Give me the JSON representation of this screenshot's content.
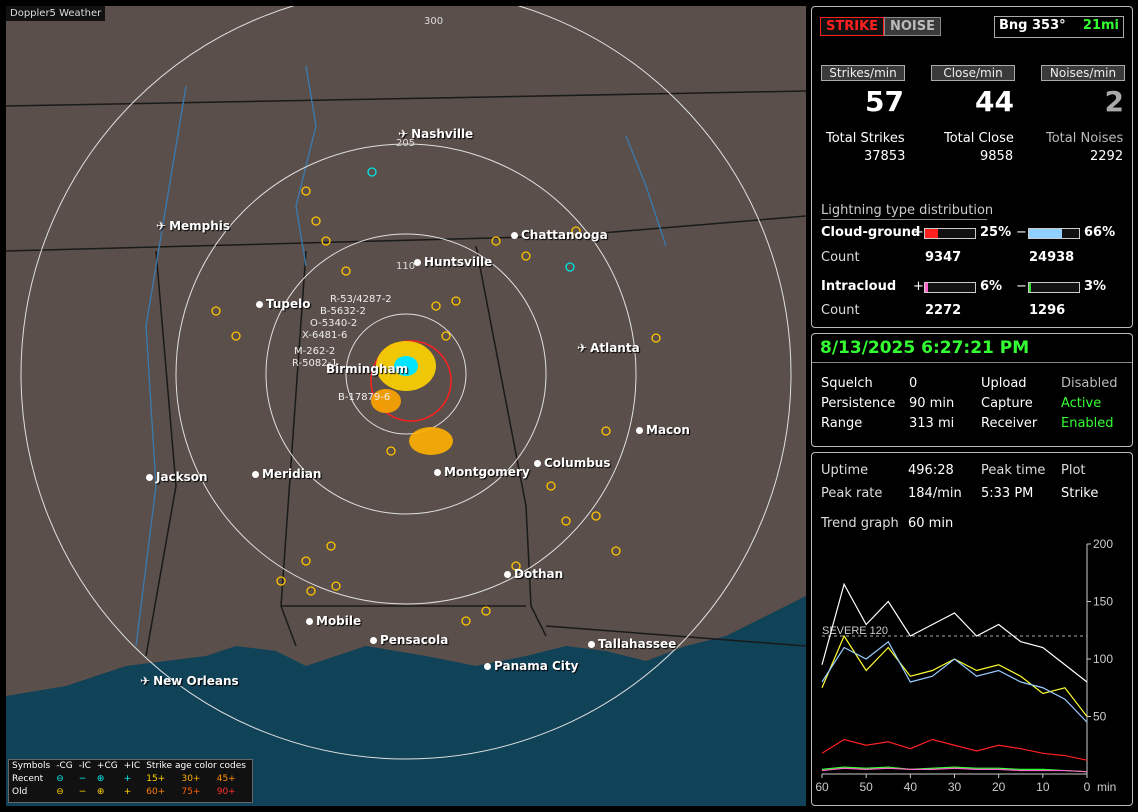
{
  "map": {
    "title": "Doppler5 Weather",
    "ring_labels": [
      "300",
      "205",
      "110"
    ],
    "cities": [
      {
        "name": "Nashville",
        "kind": "airport"
      },
      {
        "name": "Memphis",
        "kind": "airport"
      },
      {
        "name": "Chattanooga",
        "kind": "city"
      },
      {
        "name": "Huntsville",
        "kind": "city"
      },
      {
        "name": "Tupelo",
        "kind": "city"
      },
      {
        "name": "Atlanta",
        "kind": "airport"
      },
      {
        "name": "Birmingham",
        "kind": "city"
      },
      {
        "name": "Macon",
        "kind": "city"
      },
      {
        "name": "Jackson",
        "kind": "city"
      },
      {
        "name": "Meridian",
        "kind": "city"
      },
      {
        "name": "Montgomery",
        "kind": "city"
      },
      {
        "name": "Columbus",
        "kind": "city"
      },
      {
        "name": "Dothan",
        "kind": "city"
      },
      {
        "name": "Mobile",
        "kind": "city"
      },
      {
        "name": "Pensacola",
        "kind": "city"
      },
      {
        "name": "Tallahassee",
        "kind": "city"
      },
      {
        "name": "Panama City",
        "kind": "city"
      },
      {
        "name": "New Orleans",
        "kind": "airport"
      }
    ],
    "storm_labels": [
      "R-53/4287-2",
      "B-5632-2",
      "O-5340-2",
      "X-6481-6",
      "M-262-2",
      "R-5082-1",
      "B-17879-6"
    ],
    "legend": {
      "header": [
        "Symbols",
        "-CG",
        "-IC",
        "+CG",
        "+IC",
        "Strike age color codes"
      ],
      "recent": {
        "label": "Recent",
        "ages": [
          "15+",
          "30+",
          "45+"
        ]
      },
      "old": {
        "label": "Old",
        "ages": [
          "60+",
          "75+",
          "90+"
        ]
      }
    }
  },
  "status": {
    "strike_btn": "STRIKE",
    "noise_btn": "NOISE",
    "bearing": "Bng 353°",
    "distance": "21mi",
    "strikes_min_label": "Strikes/min",
    "close_min_label": "Close/min",
    "noises_min_label": "Noises/min",
    "strikes_min": "57",
    "close_min": "44",
    "noises_min": "2",
    "total_strikes_label": "Total Strikes",
    "total_close_label": "Total Close",
    "total_noises_label": "Total Noises",
    "total_strikes": "37853",
    "total_close": "9858",
    "total_noises": "2292",
    "dist_title": "Lightning type distribution",
    "cg_label": "Cloud-ground",
    "ic_label": "Intracloud",
    "count_label": "Count",
    "plus": "+",
    "minus": "−",
    "cg_pos_pct": "25%",
    "cg_neg_pct": "66%",
    "cg_pos_count": "9347",
    "cg_neg_count": "24938",
    "ic_pos_pct": "6%",
    "ic_neg_pct": "3%",
    "ic_pos_count": "2272",
    "ic_neg_count": "1296",
    "cg_pos_frac": 0.25,
    "cg_neg_frac": 0.66,
    "ic_pos_frac": 0.06,
    "ic_neg_frac": 0.03
  },
  "settings": {
    "datetime": "8/13/2025 6:27:21 PM",
    "rows": [
      {
        "k": "Squelch",
        "v": "0",
        "k2": "Upload",
        "v2": "Disabled",
        "v2_green": false
      },
      {
        "k": "Persistence",
        "v": "90 min",
        "k2": "Capture",
        "v2": "Active",
        "v2_green": true
      },
      {
        "k": "Range",
        "v": "313 mi",
        "k2": "Receiver",
        "v2": "Enabled",
        "v2_green": true
      }
    ]
  },
  "trend": {
    "uptime_label": "Uptime",
    "uptime": "496:28",
    "peak_time_label": "Peak time",
    "plot_label": "Plot",
    "peak_rate_label": "Peak rate",
    "peak_rate": "184/min",
    "peak_time": "5:33 PM",
    "plot_value": "Strike",
    "trend_label": "Trend graph",
    "trend_value": "60 min",
    "severe_label": "SEVERE 120",
    "x_unit": "min"
  },
  "chart_data": {
    "type": "line",
    "x": [
      60,
      55,
      50,
      45,
      40,
      35,
      30,
      25,
      20,
      15,
      10,
      5,
      0
    ],
    "x_ticks": [
      "60",
      "50",
      "40",
      "30",
      "20",
      "10",
      "0"
    ],
    "y_ticks": [
      "200",
      "150",
      "100",
      "50"
    ],
    "ylim": [
      0,
      200
    ],
    "threshold": 120,
    "series": [
      {
        "color": "#ffffff",
        "values": [
          95,
          165,
          130,
          150,
          120,
          130,
          140,
          120,
          130,
          115,
          110,
          95,
          80
        ]
      },
      {
        "color": "#ffff33",
        "values": [
          75,
          120,
          90,
          110,
          85,
          90,
          100,
          90,
          95,
          85,
          70,
          75,
          50
        ]
      },
      {
        "color": "#99ccff",
        "values": [
          80,
          110,
          100,
          115,
          80,
          85,
          100,
          85,
          90,
          80,
          75,
          65,
          45
        ]
      },
      {
        "color": "#ff2020",
        "values": [
          18,
          30,
          25,
          28,
          22,
          30,
          25,
          20,
          25,
          22,
          18,
          16,
          12
        ]
      },
      {
        "color": "#33ff33",
        "values": [
          4,
          6,
          5,
          6,
          4,
          5,
          6,
          5,
          5,
          4,
          4,
          3,
          2
        ]
      },
      {
        "color": "#ff66cc",
        "values": [
          3,
          5,
          4,
          5,
          4,
          4,
          5,
          4,
          4,
          3,
          3,
          3,
          2
        ]
      }
    ]
  }
}
